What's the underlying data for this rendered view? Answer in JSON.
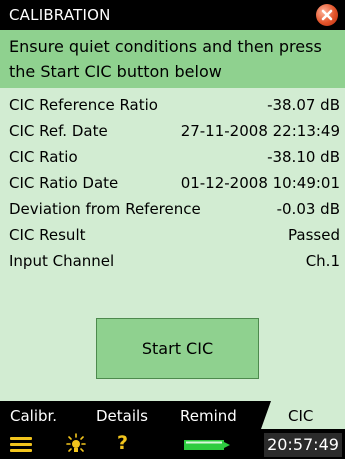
{
  "window": {
    "title": "CALIBRATION"
  },
  "instruction": {
    "line1": "Ensure quiet conditions and then press",
    "line2": "the Start CIC button below"
  },
  "rows": [
    {
      "label": "CIC Reference Ratio",
      "value": "-38.07 dB"
    },
    {
      "label": "CIC Ref. Date",
      "value": "27-11-2008 22:13:49"
    },
    {
      "label": "CIC Ratio",
      "value": "-38.10 dB"
    },
    {
      "label": "CIC Ratio Date",
      "value": "01-12-2008 10:49:01"
    },
    {
      "label": "Deviation from Reference",
      "value": "-0.03 dB"
    },
    {
      "label": "CIC Result",
      "value": "Passed"
    },
    {
      "label": "Input Channel",
      "value": "Ch.1"
    }
  ],
  "start_button": {
    "label": "Start CIC"
  },
  "tabs": [
    {
      "label": "Calibr."
    },
    {
      "label": "Details"
    },
    {
      "label": "Remind"
    },
    {
      "label": "CIC",
      "active": true
    }
  ],
  "statusbar": {
    "clock": "20:57:49",
    "icons": [
      "menu-icon",
      "bulb-icon",
      "help-icon",
      "battery-icon"
    ],
    "help_glyph": "?"
  },
  "colors": {
    "background": "#d2ecd2",
    "accent_green": "#8fd18f",
    "bar_black": "#000000",
    "icon_yellow": "#f2c51d",
    "close_orange": "#e3542a",
    "battery_green": "#2ecc40"
  }
}
